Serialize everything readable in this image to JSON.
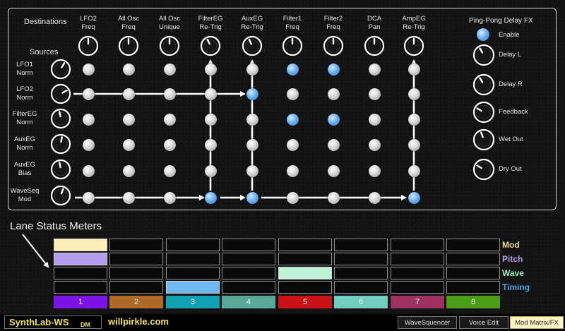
{
  "matrix": {
    "destinations_title": "Destinations",
    "sources_title": "Sources",
    "destinations": [
      {
        "l1": "LFO2",
        "l2": "Freq"
      },
      {
        "l1": "All Osc",
        "l2": "Freq"
      },
      {
        "l1": "All Osc",
        "l2": "Unique"
      },
      {
        "l1": "FilterEG",
        "l2": "Re-Trig"
      },
      {
        "l1": "AuxEG",
        "l2": "Re-Trig"
      },
      {
        "l1": "Filter1",
        "l2": "Freq"
      },
      {
        "l1": "Filter2",
        "l2": "Freq"
      },
      {
        "l1": "DCA",
        "l2": "Pan"
      },
      {
        "l1": "AmpEG",
        "l2": "Re-Trig"
      }
    ],
    "sources": [
      {
        "l1": "LFO1",
        "l2": "Norm"
      },
      {
        "l1": "LFO2",
        "l2": "Norm"
      },
      {
        "l1": "FilterEG",
        "l2": "Norm"
      },
      {
        "l1": "AuxEG",
        "l2": "Norm"
      },
      {
        "l1": "AuxEG",
        "l2": "Bias"
      },
      {
        "l1": "WaveSeq",
        "l2": "Mod"
      }
    ],
    "active": [
      [
        0,
        5
      ],
      [
        0,
        6
      ],
      [
        1,
        4
      ],
      [
        2,
        5
      ],
      [
        2,
        6
      ],
      [
        5,
        3
      ],
      [
        5,
        4
      ],
      [
        5,
        8
      ]
    ]
  },
  "fx": {
    "title": "Ping-Pong Delay FX",
    "enable_label": "Enable",
    "enabled": true,
    "knobs": [
      "Delay L",
      "Delay R",
      "Feedback",
      "Wet Out",
      "Dry Out"
    ]
  },
  "lanes": {
    "annotation": "Lane Status Meters",
    "rows": [
      {
        "label": "Mod",
        "color": "#e8dc98"
      },
      {
        "label": "Pitch",
        "color": "#b59ef0"
      },
      {
        "label": "Wave",
        "color": "#9ee8c8"
      },
      {
        "label": "Timing",
        "color": "#4da8ea"
      }
    ],
    "buttons": [
      {
        "label": "1",
        "color": "#7c14e6"
      },
      {
        "label": "2",
        "color": "#b06a28"
      },
      {
        "label": "3",
        "color": "#11a1b4"
      },
      {
        "label": "4",
        "color": "#5aa89a"
      },
      {
        "label": "5",
        "color": "#c81217"
      },
      {
        "label": "6",
        "color": "#6fcec0"
      },
      {
        "label": "7",
        "color": "#9c3162"
      },
      {
        "label": "8",
        "color": "#4a9e17"
      }
    ],
    "lit": [
      [
        0,
        0,
        "#fcefb8"
      ],
      [
        1,
        0,
        "#b59ef0"
      ],
      [
        2,
        4,
        "#bdf3da"
      ],
      [
        3,
        2,
        "#6db8f3"
      ]
    ]
  },
  "footer": {
    "brand_main": "SynthLab-WS",
    "brand_sub": "DM",
    "site": "willpirkle.com",
    "tabs": [
      "WaveSquencer",
      "Voice Edit",
      "Mod Matrix/FX"
    ],
    "active_tab": 2
  }
}
